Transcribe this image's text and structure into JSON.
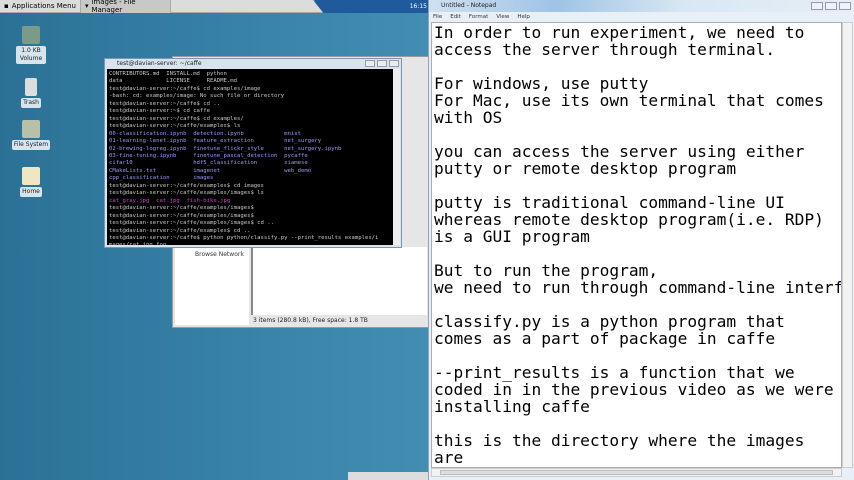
{
  "taskbar": {
    "apps_menu": "Applications Menu",
    "task": "images - File Manager",
    "clock": "16:15"
  },
  "desktop": {
    "icons": [
      {
        "label": "1.0 KB Volume"
      },
      {
        "label": "Trash"
      },
      {
        "label": "File System"
      },
      {
        "label": "Home"
      }
    ]
  },
  "file_manager": {
    "sidebar_item": "Browse Network",
    "status": "3 items (280.8 kB), Free space: 1.8 TB"
  },
  "terminal": {
    "title": "test@davian-server: ~/caffe",
    "lines": [
      "CONTRIBUTORS.md  INSTALL.md  python",
      "data             LICENSE     README.md",
      "test@davian-server:~/caffe$ cd examples/image",
      "-bash: cd: examples/image: No such file or directory",
      "test@davian-server:~/caffe$ cd ..",
      "test@davian-server:~$ cd caffe",
      "test@davian-server:~/caffe$ cd examples/",
      "test@davian-server:~/caffe/examples$ ls",
      "00-classification.ipynb  detection.ipynb            mnist",
      "01-learning-lenet.ipynb  feature_extraction         net_surgery",
      "02-brewing-logreg.ipynb  finetune_flickr_style      net_surgery.ipynb",
      "03-fine-tuning.ipynb     finetune_pascal_detection  pycaffe",
      "cifar10                  hdf5_classification        siamese",
      "CMakeLists.txt           imagenet                   web_demo",
      "cpp_classification       images",
      "test@davian-server:~/caffe/examples$ cd images",
      "test@davian-server:~/caffe/examples/images$ ls",
      "cat_gray.jpg  cat.jpg  fish-bike.jpg",
      "test@davian-server:~/caffe/examples/images$",
      "test@davian-server:~/caffe/examples/images$",
      "test@davian-server:~/caffe/examples/images$ cd ..",
      "test@davian-server:~/caffe/examples$ cd ..",
      "test@davian-server:~/caffe$ python python/classify.py --print_results examples/i",
      "mages/cat.jpg foo"
    ]
  },
  "notepad": {
    "title": "Untitled - Notepad",
    "menu": [
      "File",
      "Edit",
      "Format",
      "View",
      "Help"
    ],
    "text": "In order to run experiment, we need to\naccess the server through terminal.\n\nFor windows, use putty\nFor Mac, use its own terminal that comes\nwith OS\n\nyou can access the server using either\nputty or remote desktop program\n\nputty is traditional command-line UI\nwhereas remote desktop program(i.e. RDP)\nis a GUI program\n\nBut to run the program,\nwe need to run through command-line interf\n\nclassify.py is a python program that\ncomes as a part of package in caffe\n\n--print_results is a function that we\ncoded in in the previous video as we were\ninstalling caffe\n\nthis is the directory where the images\nare"
  }
}
